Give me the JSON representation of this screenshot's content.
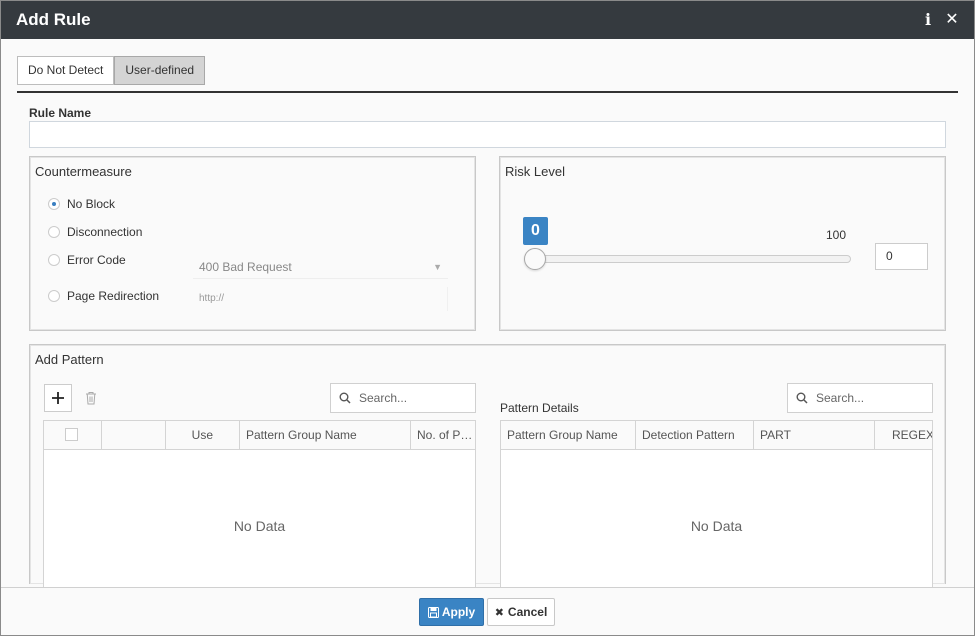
{
  "dialog": {
    "title": "Add Rule",
    "info_icon": "info-icon",
    "close_icon": "close-icon"
  },
  "tabs": [
    {
      "label": "Do Not Detect",
      "active": false
    },
    {
      "label": "User-defined",
      "active": true
    }
  ],
  "rule_name": {
    "label": "Rule Name",
    "value": ""
  },
  "countermeasure": {
    "title": "Countermeasure",
    "options": [
      {
        "label": "No Block",
        "checked": true
      },
      {
        "label": "Disconnection",
        "checked": false
      },
      {
        "label": "Error Code",
        "checked": false
      },
      {
        "label": "Page Redirection",
        "checked": false
      }
    ],
    "error_code_value": "400 Bad Request",
    "redirect_placeholder": "http://"
  },
  "risk_level": {
    "title": "Risk Level",
    "value": "0",
    "max": "100",
    "input_value": "0"
  },
  "add_pattern": {
    "title": "Add Pattern",
    "search_placeholder": "Search...",
    "columns": [
      "",
      "",
      "Use",
      "Pattern Group Name",
      "No. of P…"
    ],
    "empty_text": "No Data"
  },
  "pattern_details": {
    "title": "Pattern Details",
    "search_placeholder": "Search...",
    "columns": [
      "Pattern Group Name",
      "Detection Pattern",
      "PART",
      "REGEX"
    ],
    "empty_text": "No Data"
  },
  "footer": {
    "apply_label": "Apply",
    "cancel_label": "Cancel"
  },
  "colors": {
    "titlebar": "#353a3f",
    "accent": "#3a84c4"
  }
}
